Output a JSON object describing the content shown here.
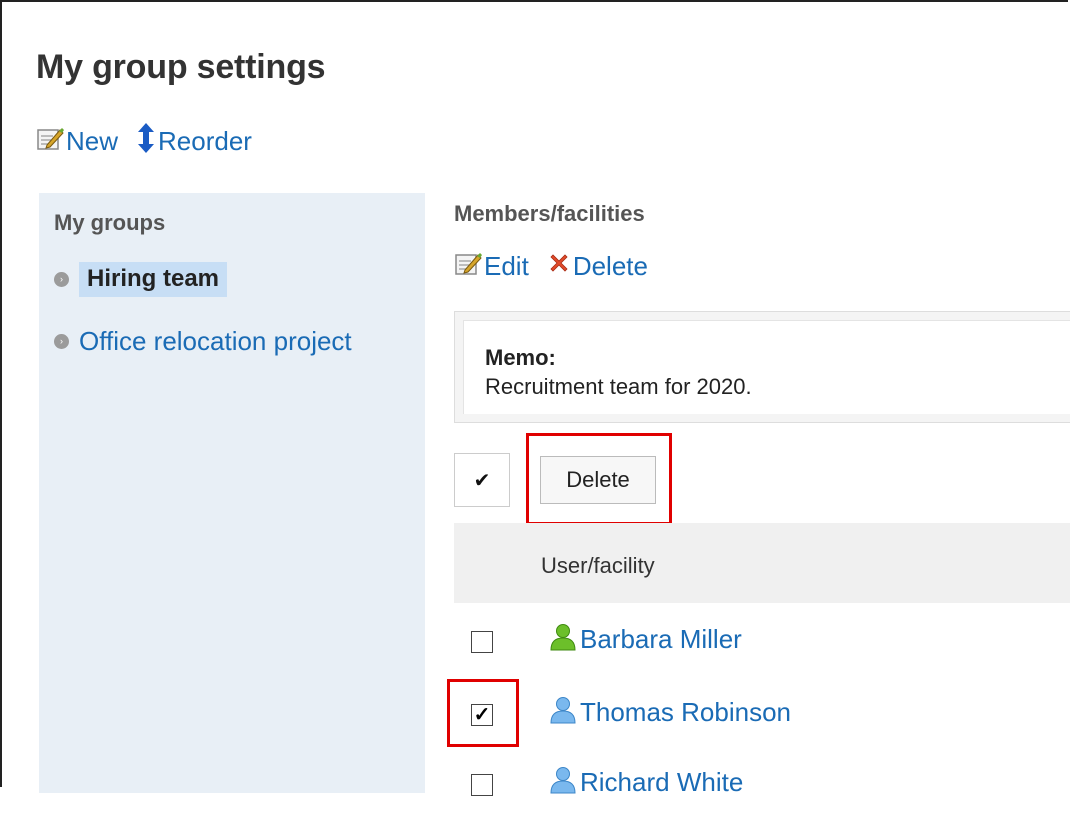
{
  "page": {
    "title": "My group settings"
  },
  "top_actions": {
    "new_label": "New",
    "reorder_label": "Reorder"
  },
  "sidebar": {
    "title": "My groups",
    "items": [
      {
        "label": "Hiring team",
        "selected": true
      },
      {
        "label": "Office relocation project",
        "selected": false
      }
    ]
  },
  "main": {
    "section_title": "Members/facilities",
    "actions": {
      "edit_label": "Edit",
      "delete_label": "Delete"
    },
    "memo": {
      "label": "Memo:",
      "text": "Recruitment team for 2020."
    },
    "toolbar": {
      "select_all_glyph": "✔",
      "delete_button_label": "Delete"
    },
    "table": {
      "column_header": "User/facility",
      "rows": [
        {
          "name": "Barbara Miller",
          "checked": false,
          "icon": "user-icon-green"
        },
        {
          "name": "Thomas Robinson",
          "checked": true,
          "icon": "user-icon-blue"
        },
        {
          "name": "Richard White",
          "checked": false,
          "icon": "user-icon-blue"
        }
      ]
    }
  },
  "colors": {
    "link": "#1a6bb5",
    "sidebar_bg": "#e8eff6",
    "selected_bg": "#c7def5",
    "highlight": "#e00000"
  }
}
